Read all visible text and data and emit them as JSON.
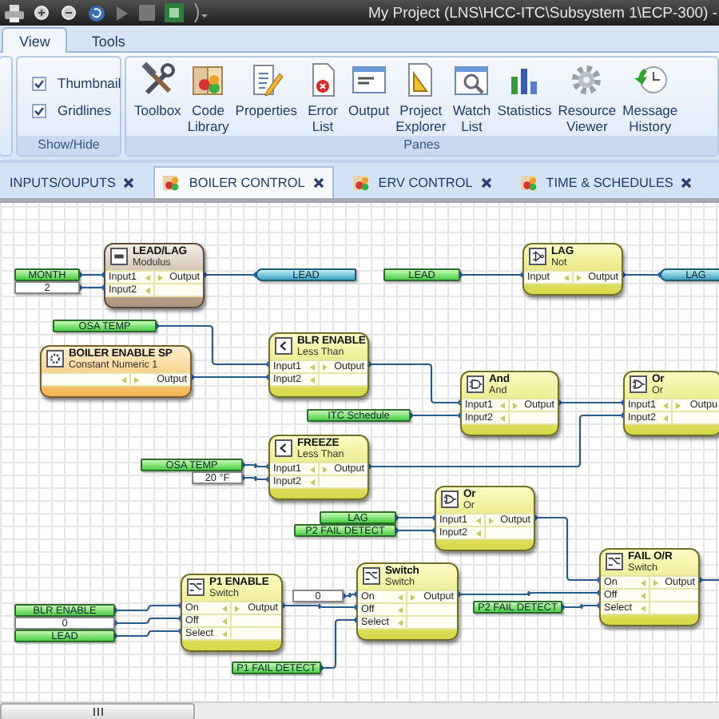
{
  "title_bar": {
    "title": "My Project (LNS\\HCC-ITC\\Subsystem 1\\ECP-300) -"
  },
  "ribbon_tabs": [
    {
      "label": "View",
      "selected": true
    },
    {
      "label": "Tools",
      "selected": false
    }
  ],
  "show_hide": {
    "label": "Show/Hide",
    "options": [
      {
        "label": "Thumbnail",
        "checked": true
      },
      {
        "label": "Gridlines",
        "checked": true
      }
    ]
  },
  "panes": {
    "label": "Panes",
    "buttons": [
      {
        "lines": [
          "Toolbox"
        ]
      },
      {
        "lines": [
          "Code",
          "Library"
        ]
      },
      {
        "lines": [
          "Properties"
        ]
      },
      {
        "lines": [
          "Error",
          "List"
        ]
      },
      {
        "lines": [
          "Output"
        ]
      },
      {
        "lines": [
          "Project",
          "Explorer"
        ]
      },
      {
        "lines": [
          "Watch",
          "List"
        ]
      },
      {
        "lines": [
          "Statistics"
        ]
      },
      {
        "lines": [
          "Resource",
          "Viewer"
        ]
      },
      {
        "lines": [
          "Message",
          "History"
        ]
      }
    ]
  },
  "document_tabs": [
    {
      "label": "INPUTS/OUPUTS",
      "selected": false
    },
    {
      "label": "BOILER CONTROL",
      "selected": true
    },
    {
      "label": "ERV CONTROL",
      "selected": false
    },
    {
      "label": "TIME & SCHEDULES",
      "selected": false
    }
  ],
  "diagram": {
    "blocks": [
      {
        "title": "LEAD/LAG",
        "subtitle": "Modulus",
        "kind": "modulus",
        "inputs": [
          "Input1",
          "Input2"
        ],
        "output": "Output"
      },
      {
        "title": "LAG",
        "subtitle": "Not",
        "kind": "not",
        "inputs": [
          "Input"
        ],
        "output": "Output"
      },
      {
        "title": "BOILER ENABLE SP",
        "subtitle": "Constant Numeric 1",
        "kind": "constant",
        "output": "Output"
      },
      {
        "title": "BLR ENABLE",
        "subtitle": "Less Than",
        "kind": "less_than",
        "inputs": [
          "Input1",
          "Input2"
        ],
        "output": "Output"
      },
      {
        "title": "And",
        "subtitle": "And",
        "kind": "and",
        "inputs": [
          "Input1",
          "Input2"
        ],
        "output": "Output"
      },
      {
        "title": "Or",
        "subtitle": "Or",
        "kind": "or",
        "inputs": [
          "Input1",
          "Input2"
        ],
        "output": "Outpu"
      },
      {
        "title": "FREEZE",
        "subtitle": "Less Than",
        "kind": "less_than",
        "inputs": [
          "Input1",
          "Input2"
        ],
        "output": "Output"
      },
      {
        "title": "Or",
        "subtitle": "Or",
        "kind": "or",
        "inputs": [
          "Input1",
          "Input2"
        ],
        "output": "Output"
      },
      {
        "title": "P1 ENABLE",
        "subtitle": "Switch",
        "kind": "switch",
        "inputs": [
          "On",
          "Off",
          "Select"
        ],
        "output": "Output"
      },
      {
        "title": "Switch",
        "subtitle": "Switch",
        "kind": "switch",
        "inputs": [
          "On",
          "Off",
          "Select"
        ],
        "output": "Output"
      },
      {
        "title": "FAIL O/R",
        "subtitle": "Switch",
        "kind": "switch",
        "inputs": [
          "On",
          "Off",
          "Select"
        ],
        "output": "Output"
      }
    ],
    "tags": [
      {
        "text": "MONTH",
        "kind": "input"
      },
      {
        "text": "2",
        "kind": "value"
      },
      {
        "text": "LEAD",
        "kind": "output"
      },
      {
        "text": "LEAD",
        "kind": "input"
      },
      {
        "text": "LAG",
        "kind": "output"
      },
      {
        "text": "OSA TEMP",
        "kind": "input"
      },
      {
        "text": "ITC Schedule",
        "kind": "input"
      },
      {
        "text": "OSA TEMP",
        "kind": "input"
      },
      {
        "text": "20 °F",
        "kind": "value"
      },
      {
        "text": "LAG",
        "kind": "input"
      },
      {
        "text": "P2 FAIL DETECT",
        "kind": "input"
      },
      {
        "text": "BLR ENABLE",
        "kind": "input"
      },
      {
        "text": "0",
        "kind": "value"
      },
      {
        "text": "LEAD",
        "kind": "input"
      },
      {
        "text": "0",
        "kind": "value"
      },
      {
        "text": "P1 FAIL DETECT",
        "kind": "input"
      },
      {
        "text": "P2 FAIL DETECT",
        "kind": "input"
      }
    ]
  }
}
